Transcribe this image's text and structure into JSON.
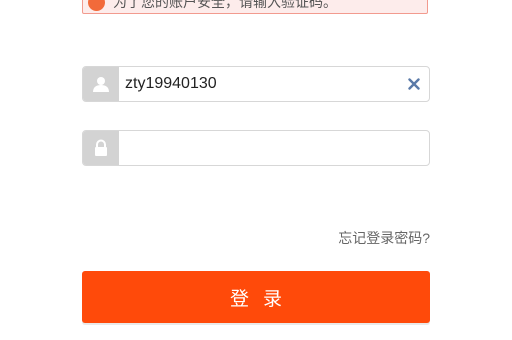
{
  "notice": {
    "icon": "warning-icon",
    "text": "为了您的账户安全，请输入验证码。"
  },
  "username_field": {
    "icon": "user-icon",
    "value": "zty19940130",
    "clear_icon": "close-icon"
  },
  "password_field": {
    "icon": "lock-icon",
    "value": ""
  },
  "forgot_password": {
    "label": "忘记登录密码?"
  },
  "login_button": {
    "label": "登录"
  },
  "colors": {
    "accent": "#ff4a0a",
    "notice_border": "#f29a8e",
    "icon_bg": "#d3d3d3",
    "clear_icon": "#5a7aa8"
  }
}
